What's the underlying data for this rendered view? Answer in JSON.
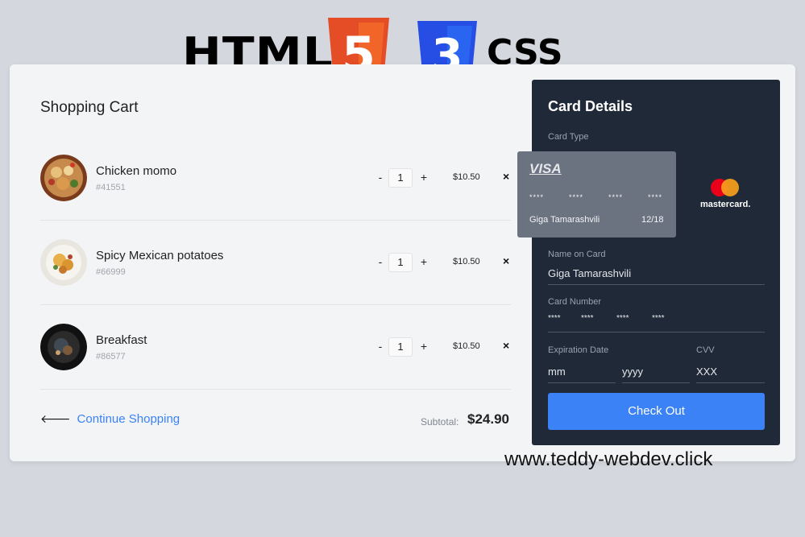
{
  "banner": {
    "html_text": "HTML",
    "html_shield_number": "5",
    "css_shield_number": "3",
    "css_text": "CSS"
  },
  "cart": {
    "title": "Shopping Cart",
    "items": [
      {
        "name": "Chicken momo",
        "code": "#41551",
        "quantity": "1",
        "price": "$10.50",
        "image": "momo-plate-image"
      },
      {
        "name": "Spicy Mexican potatoes",
        "code": "#66999",
        "quantity": "1",
        "price": "$10.50",
        "image": "potatoes-plate-image"
      },
      {
        "name": "Breakfast",
        "code": "#86577",
        "quantity": "1",
        "price": "$10.50",
        "image": "breakfast-plate-image"
      }
    ],
    "minus": "-",
    "plus": "+",
    "remove": "×",
    "continue_arrow": "🡐",
    "continue_label": "Continue Shopping",
    "subtotal_label": "Subtotal:",
    "subtotal_value": "$24.90"
  },
  "card": {
    "title": "Card Details",
    "card_type_label": "Card Type",
    "mastercard_label": "mastercard.",
    "name_label": "Name on Card",
    "name_value": "Giga Tamarashvili",
    "number_label": "Card Number",
    "number_groups": [
      "****",
      "****",
      "****",
      "****"
    ],
    "expiration_label": "Expiration Date",
    "month_placeholder": "mm",
    "year_placeholder": "yyyy",
    "cvv_label": "CVV",
    "cvv_placeholder": "XXX",
    "checkout_label": "Check Out"
  },
  "visa_card": {
    "brand": "VISA",
    "number_groups": [
      "****",
      "****",
      "****",
      "****"
    ],
    "holder": "Giga Tamarashvili",
    "expiry": "12/18"
  },
  "watermark": "www.teddy-webdev.click",
  "colors": {
    "accent": "#3b82f6",
    "card_panel": "#1f2937",
    "background": "#d4d7de",
    "html_orange": "#e44d26",
    "css_blue": "#264de4"
  }
}
